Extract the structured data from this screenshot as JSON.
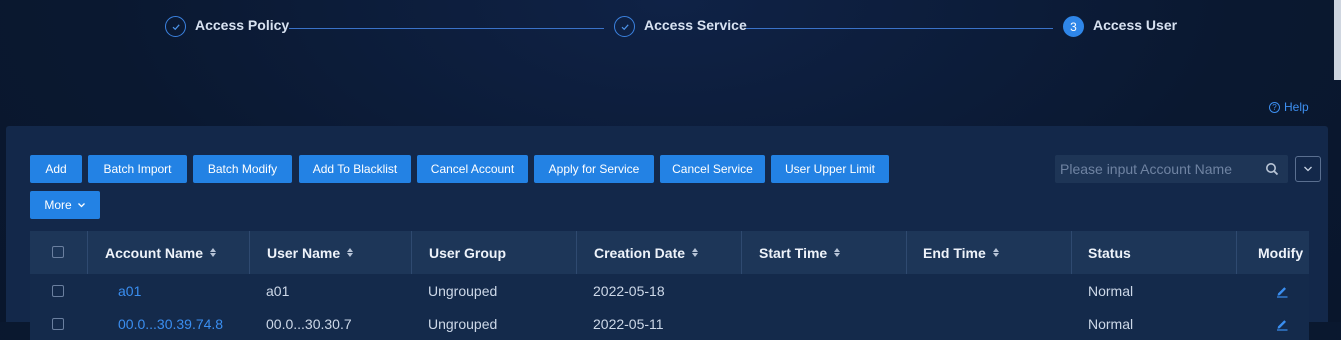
{
  "steps": [
    {
      "label": "Access Policy",
      "state": "done",
      "icon": "check-icon"
    },
    {
      "label": "Access Service",
      "state": "done",
      "icon": "check-icon"
    },
    {
      "label": "Access User",
      "state": "active",
      "number": "3"
    }
  ],
  "help": {
    "icon": "help-circle-icon",
    "label": "Help"
  },
  "toolbar": {
    "buttons": [
      "Add",
      "Batch Import",
      "Batch Modify",
      "Add To Blacklist",
      "Cancel Account",
      "Apply for Service",
      "Cancel Service",
      "User Upper Limit"
    ],
    "more_label": "More",
    "search_placeholder": "Please input Account Name"
  },
  "table": {
    "columns": [
      "Account Name",
      "User Name",
      "User Group",
      "Creation Date",
      "Start Time",
      "End Time",
      "Status",
      "Modify"
    ],
    "rows": [
      {
        "account": "a01",
        "user": "a01",
        "group": "Ungrouped",
        "created": "2022-05-18",
        "start": "",
        "end": "",
        "status": "Normal"
      },
      {
        "account": "00.0...30.39.74.8",
        "user": "00.0...30.30.7",
        "group": "Ungrouped",
        "created": "2022-05-11",
        "start": "",
        "end": "",
        "status": "Normal"
      }
    ]
  },
  "colors": {
    "accent": "#2382e4",
    "link": "#3a8ef0",
    "panel": "#13284a",
    "header": "#1d3658"
  }
}
